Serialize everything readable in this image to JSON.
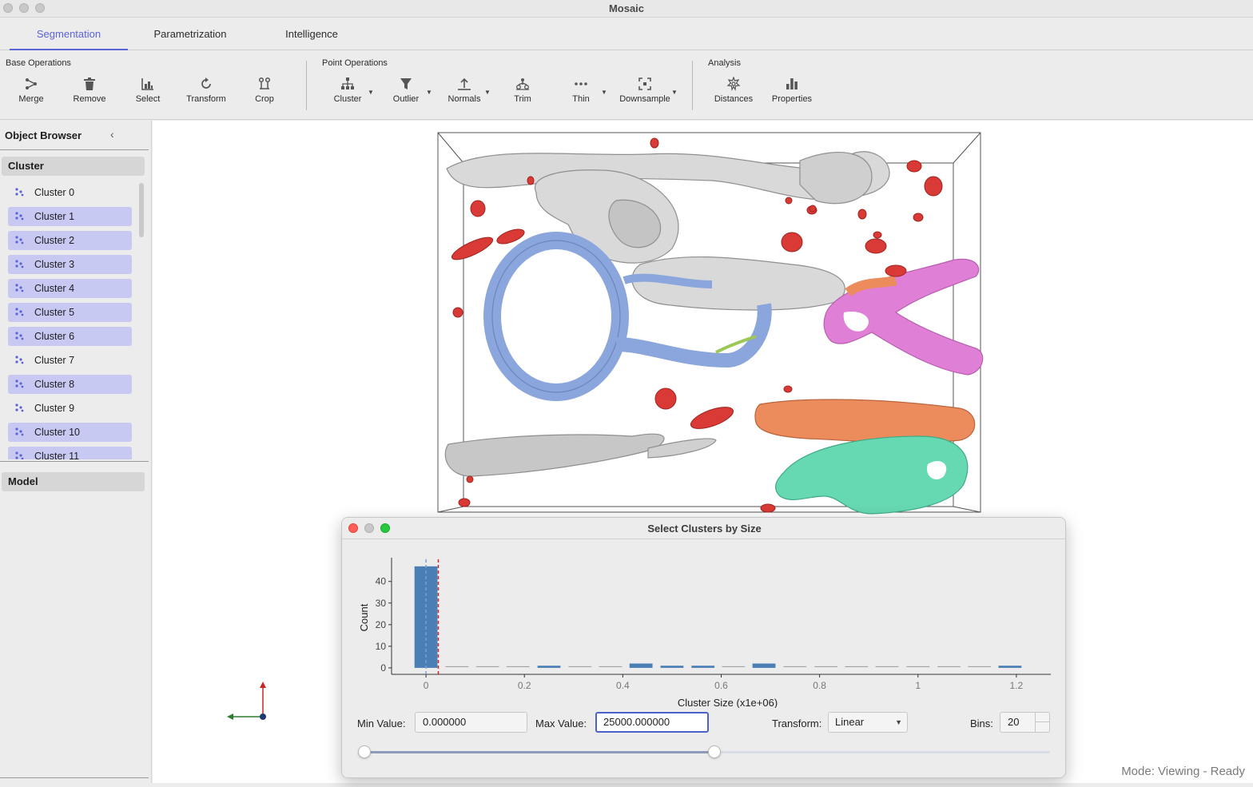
{
  "window": {
    "title": "Mosaic"
  },
  "tabs": [
    {
      "label": "Segmentation",
      "active": true
    },
    {
      "label": "Parametrization",
      "active": false
    },
    {
      "label": "Intelligence",
      "active": false
    }
  ],
  "ribbon": {
    "groups": [
      {
        "label": "Base Operations"
      },
      {
        "label": "Point Operations"
      },
      {
        "label": "Analysis"
      }
    ],
    "buttons": [
      {
        "label": "Merge",
        "icon": "merge-icon",
        "dropdown": false
      },
      {
        "label": "Remove",
        "icon": "trash-icon",
        "dropdown": false
      },
      {
        "label": "Select",
        "icon": "select-icon",
        "dropdown": false
      },
      {
        "label": "Transform",
        "icon": "rotate-icon",
        "dropdown": false
      },
      {
        "label": "Crop",
        "icon": "crop-icon",
        "dropdown": false
      },
      {
        "label": "Cluster",
        "icon": "hierarchy-icon",
        "dropdown": true
      },
      {
        "label": "Outlier",
        "icon": "filter-icon",
        "dropdown": true
      },
      {
        "label": "Normals",
        "icon": "normals-icon",
        "dropdown": true
      },
      {
        "label": "Trim",
        "icon": "trim-icon",
        "dropdown": false
      },
      {
        "label": "Thin",
        "icon": "dots-icon",
        "dropdown": true
      },
      {
        "label": "Downsample",
        "icon": "downsample-icon",
        "dropdown": true
      },
      {
        "label": "Distances",
        "icon": "distances-icon",
        "dropdown": false
      },
      {
        "label": "Properties",
        "icon": "bar-chart-icon",
        "dropdown": false
      }
    ]
  },
  "sidebar": {
    "title": "Object Browser",
    "cluster_section": "Cluster",
    "model_section": "Model",
    "items": [
      {
        "label": "Cluster 0",
        "selected": false
      },
      {
        "label": "Cluster 1",
        "selected": true
      },
      {
        "label": "Cluster 2",
        "selected": true
      },
      {
        "label": "Cluster 3",
        "selected": true
      },
      {
        "label": "Cluster 4",
        "selected": true
      },
      {
        "label": "Cluster 5",
        "selected": true
      },
      {
        "label": "Cluster 6",
        "selected": true
      },
      {
        "label": "Cluster 7",
        "selected": false
      },
      {
        "label": "Cluster 8",
        "selected": true
      },
      {
        "label": "Cluster 9",
        "selected": false
      },
      {
        "label": "Cluster 10",
        "selected": true
      },
      {
        "label": "Cluster 11",
        "selected": true
      }
    ]
  },
  "viewport": {
    "mode_text": "Mode: Viewing - Ready",
    "colors": {
      "gray": "#d9d9d9",
      "blue": "#8aa6dc",
      "red": "#d93a35",
      "pink": "#e07fd6",
      "orange": "#ec8c5c",
      "teal": "#66d8b2",
      "green": "#9cc858"
    }
  },
  "dialog": {
    "title": "Select Clusters by Size",
    "min_label": "Min Value:",
    "min_value": "0.000000",
    "max_label": "Max Value:",
    "max_value": "25000.000000",
    "transform_label": "Transform:",
    "transform_value": "Linear",
    "bins_label": "Bins:",
    "bins_value": "20",
    "slider": {
      "min_fraction": 0.0,
      "max_fraction": 0.51
    }
  },
  "chart_data": {
    "type": "bar",
    "xlabel": "Cluster Size (x1e+06)",
    "ylabel": "Count",
    "xlim": [
      -0.07,
      1.27
    ],
    "ylim": [
      -3,
      51
    ],
    "xticks": [
      0,
      0.2,
      0.4,
      0.6,
      0.8,
      1,
      1.2
    ],
    "xtick_labels": [
      "0",
      "0.2",
      "0.4",
      "0.6",
      "0.8",
      "1",
      "1.2"
    ],
    "yticks": [
      0,
      10,
      20,
      30,
      40
    ],
    "bins": [
      {
        "x0": -0.025,
        "x1": 0.025,
        "count": 47
      },
      {
        "x0": 0.038,
        "x1": 0.088,
        "count": 0
      },
      {
        "x0": 0.1,
        "x1": 0.15,
        "count": 0
      },
      {
        "x0": 0.162,
        "x1": 0.212,
        "count": 0
      },
      {
        "x0": 0.225,
        "x1": 0.275,
        "count": 1
      },
      {
        "x0": 0.288,
        "x1": 0.338,
        "count": 0
      },
      {
        "x0": 0.35,
        "x1": 0.4,
        "count": 0
      },
      {
        "x0": 0.412,
        "x1": 0.462,
        "count": 2
      },
      {
        "x0": 0.475,
        "x1": 0.525,
        "count": 1
      },
      {
        "x0": 0.538,
        "x1": 0.588,
        "count": 1
      },
      {
        "x0": 0.6,
        "x1": 0.65,
        "count": 0
      },
      {
        "x0": 0.662,
        "x1": 0.712,
        "count": 2
      },
      {
        "x0": 0.725,
        "x1": 0.775,
        "count": 0
      },
      {
        "x0": 0.788,
        "x1": 0.838,
        "count": 0
      },
      {
        "x0": 0.85,
        "x1": 0.9,
        "count": 0
      },
      {
        "x0": 0.912,
        "x1": 0.962,
        "count": 0
      },
      {
        "x0": 0.975,
        "x1": 1.025,
        "count": 0
      },
      {
        "x0": 1.038,
        "x1": 1.088,
        "count": 0
      },
      {
        "x0": 1.1,
        "x1": 1.15,
        "count": 0
      },
      {
        "x0": 1.162,
        "x1": 1.212,
        "count": 1
      }
    ],
    "threshold_lines": [
      0,
      0.025
    ],
    "bar_color": "#4a7fb5",
    "threshold_color": "#d62728"
  }
}
